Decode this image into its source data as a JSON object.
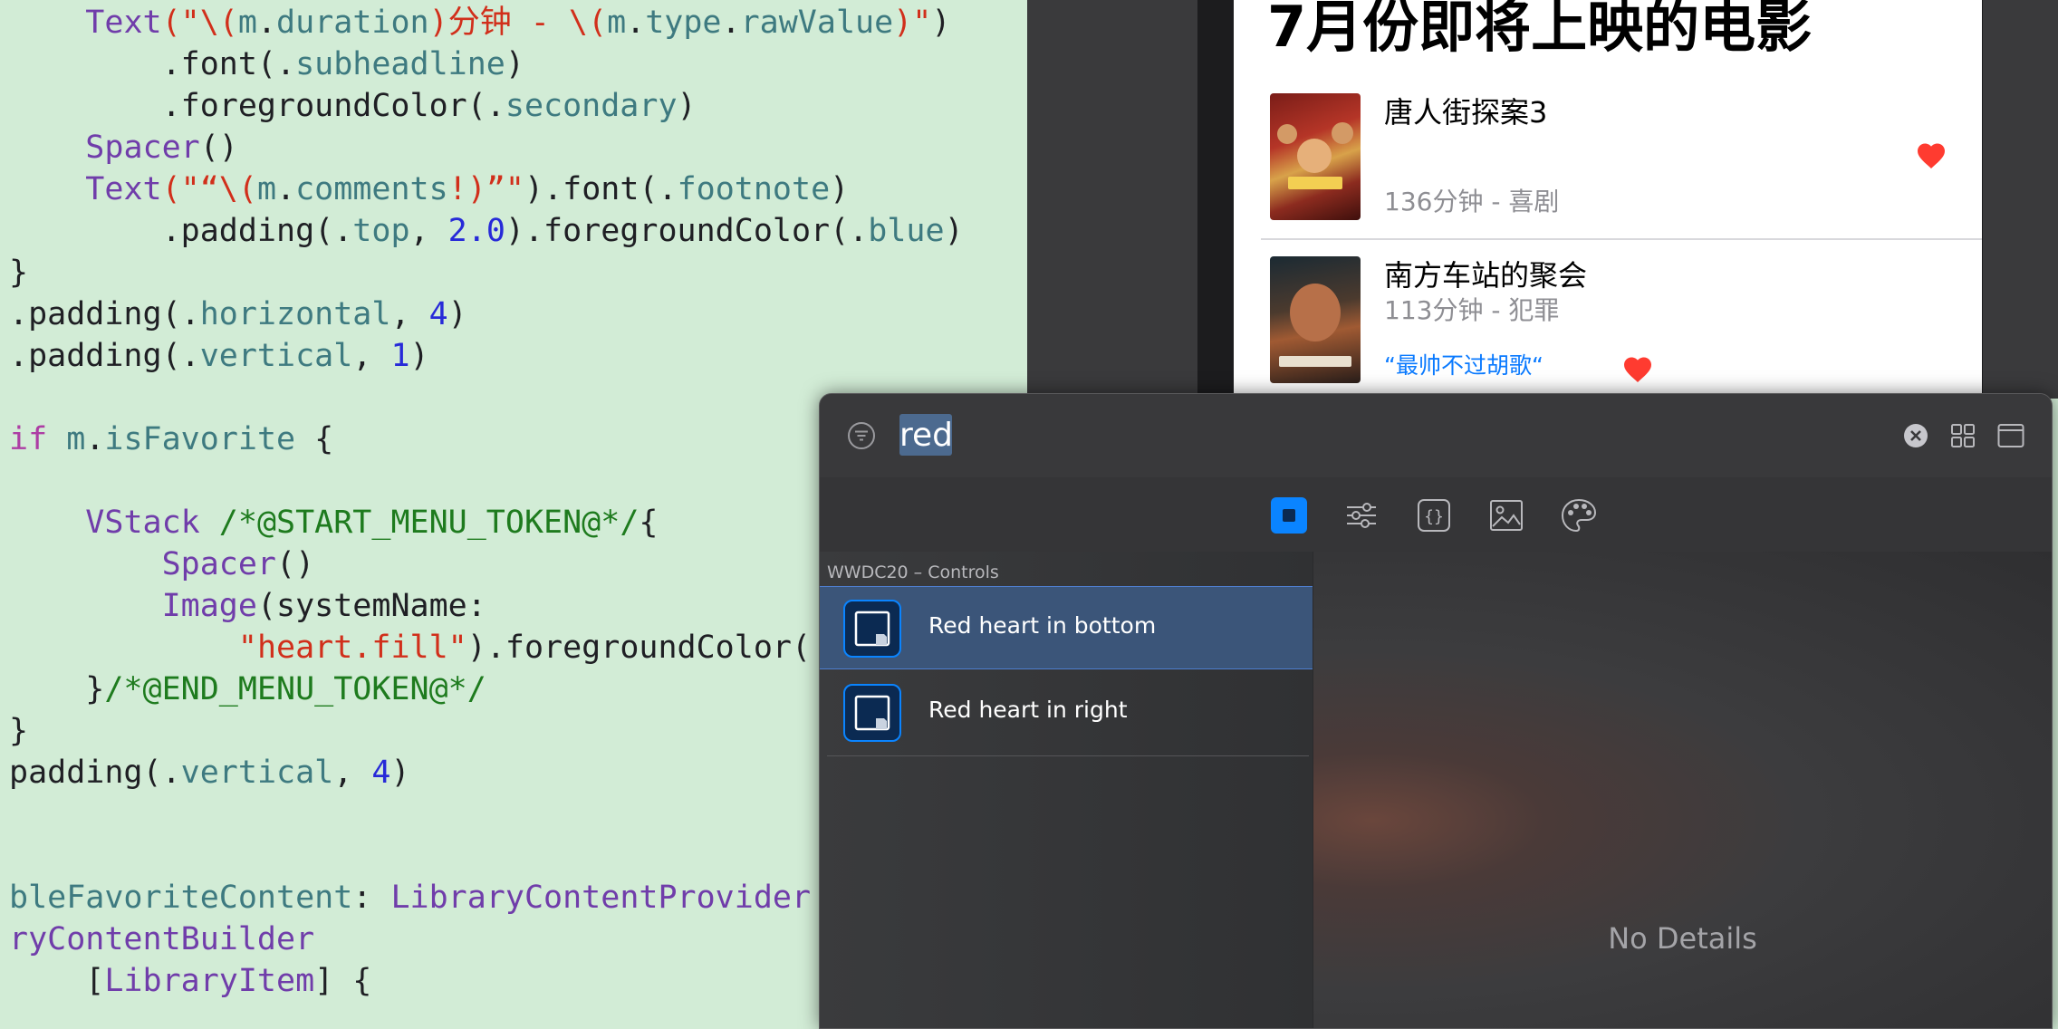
{
  "editor": {
    "lines": [
      [
        {
          "t": "    "
        },
        {
          "t": "Text",
          "c": "type"
        },
        {
          "t": "(\"\\(",
          "c": "str"
        },
        {
          "t": "m",
          "c": "prop"
        },
        {
          "t": "."
        },
        {
          "t": "duration",
          "c": "prop"
        },
        {
          "t": ")分钟 - \\(",
          "c": "str"
        },
        {
          "t": "m",
          "c": "prop"
        },
        {
          "t": "."
        },
        {
          "t": "type",
          "c": "prop"
        },
        {
          "t": "."
        },
        {
          "t": "rawValue",
          "c": "prop"
        },
        {
          "t": ")\"",
          "c": "str"
        },
        {
          "t": ")"
        }
      ],
      [
        {
          "t": "        .font(."
        },
        {
          "t": "subheadline",
          "c": "prop"
        },
        {
          "t": ")"
        }
      ],
      [
        {
          "t": "        .foregroundColor(."
        },
        {
          "t": "secondary",
          "c": "prop"
        },
        {
          "t": ")"
        }
      ],
      [
        {
          "t": "    "
        },
        {
          "t": "Spacer",
          "c": "type"
        },
        {
          "t": "()"
        }
      ],
      [
        {
          "t": "    "
        },
        {
          "t": "Text",
          "c": "type"
        },
        {
          "t": "(\"“\\(",
          "c": "str"
        },
        {
          "t": "m",
          "c": "prop"
        },
        {
          "t": "."
        },
        {
          "t": "comments",
          "c": "prop"
        },
        {
          "t": "!)”\"",
          "c": "str"
        },
        {
          "t": ").font(."
        },
        {
          "t": "footnote",
          "c": "prop"
        },
        {
          "t": ")"
        }
      ],
      [
        {
          "t": "        .padding(."
        },
        {
          "t": "top",
          "c": "prop"
        },
        {
          "t": ", "
        },
        {
          "t": "2.0",
          "c": "num"
        },
        {
          "t": ").foregroundColor(."
        },
        {
          "t": "blue",
          "c": "prop"
        },
        {
          "t": ")"
        }
      ],
      [
        {
          "t": "}"
        }
      ],
      [
        {
          "t": ".padding(."
        },
        {
          "t": "horizontal",
          "c": "prop"
        },
        {
          "t": ", "
        },
        {
          "t": "4",
          "c": "num"
        },
        {
          "t": ")"
        }
      ],
      [
        {
          "t": ".padding(."
        },
        {
          "t": "vertical",
          "c": "prop"
        },
        {
          "t": ", "
        },
        {
          "t": "1",
          "c": "num"
        },
        {
          "t": ")"
        }
      ],
      [
        {
          "t": ""
        }
      ],
      [
        {
          "t": "if",
          "c": "kw"
        },
        {
          "t": " "
        },
        {
          "t": "m",
          "c": "prop"
        },
        {
          "t": "."
        },
        {
          "t": "isFavorite",
          "c": "prop"
        },
        {
          "t": " {"
        }
      ],
      [
        {
          "t": ""
        }
      ],
      [
        {
          "t": "    "
        },
        {
          "t": "VStack",
          "c": "type"
        },
        {
          "t": " /*@START_MENU_TOKEN@*/",
          "c": "cmt"
        },
        {
          "t": "{"
        }
      ],
      [
        {
          "t": "        "
        },
        {
          "t": "Spacer",
          "c": "type"
        },
        {
          "t": "()"
        }
      ],
      [
        {
          "t": "        "
        },
        {
          "t": "Image",
          "c": "type"
        },
        {
          "t": "(systemName:"
        }
      ],
      [
        {
          "t": "            "
        },
        {
          "t": "\"heart.fill\"",
          "c": "str"
        },
        {
          "t": ").foregroundColor("
        }
      ],
      [
        {
          "t": "    }"
        },
        {
          "t": "/*@END_MENU_TOKEN@*/",
          "c": "cmt"
        }
      ],
      [
        {
          "t": "}"
        }
      ],
      [
        {
          "t": "padding(."
        },
        {
          "t": "vertical",
          "c": "prop"
        },
        {
          "t": ", "
        },
        {
          "t": "4",
          "c": "num"
        },
        {
          "t": ")"
        }
      ],
      [
        {
          "t": ""
        }
      ],
      [
        {
          "t": ""
        }
      ],
      [
        {
          "t": "bleFavoriteContent",
          "c": "prop"
        },
        {
          "t": ": "
        },
        {
          "t": "LibraryContentProvider",
          "c": "type"
        },
        {
          "t": " {"
        }
      ],
      [
        {
          "t": "ryContentBuilder",
          "c": "type"
        }
      ],
      [
        {
          "t": "    ["
        },
        {
          "t": "LibraryItem",
          "c": "type"
        },
        {
          "t": "] {"
        }
      ]
    ]
  },
  "simulator": {
    "title": "7月份即将上映的电影",
    "movies": [
      {
        "name": "唐人街探案3",
        "meta": "136分钟 - 喜剧",
        "comment": ""
      },
      {
        "name": "南方车站的聚会",
        "meta": "113分钟 - 犯罪",
        "comment": "“最帅不过胡歌“"
      }
    ],
    "heart_color": "#ff3b30"
  },
  "library": {
    "search": {
      "value": "red"
    },
    "icons": {
      "filter": "filter-icon",
      "clear": "clear-search-icon",
      "grid": "grid-view-icon",
      "window": "window-icon"
    },
    "tabs": [
      "views",
      "modifiers",
      "snippets",
      "media",
      "colors"
    ],
    "selected_tab": "views",
    "group_header": "WWDC20 – Controls",
    "items": [
      {
        "label": "Red heart in bottom",
        "selected": true
      },
      {
        "label": "Red heart in right",
        "selected": false
      }
    ],
    "detail_placeholder": "No Details",
    "accent_color": "#0a84ff"
  }
}
